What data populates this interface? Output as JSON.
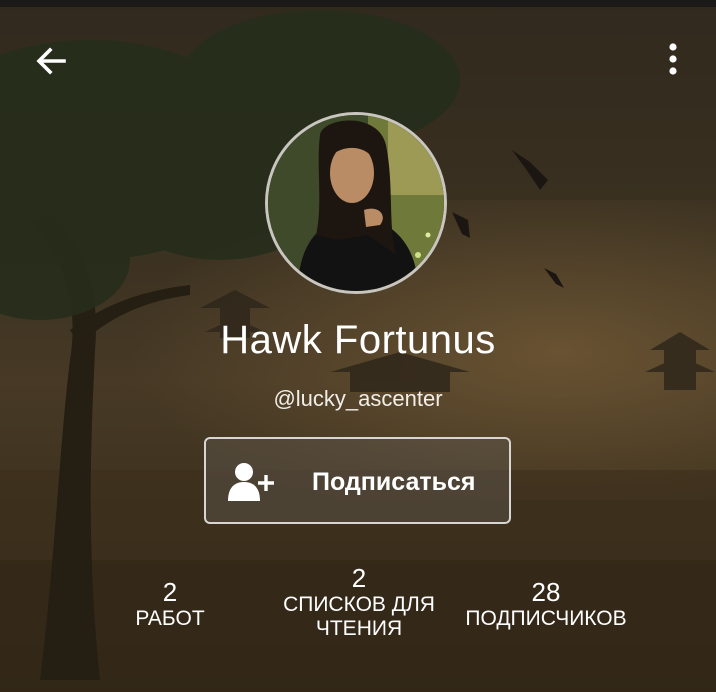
{
  "toolbar": {
    "back_icon": "arrow-left-icon",
    "menu_icon": "more-vertical-icon"
  },
  "profile": {
    "name": "Hawk Fortunus",
    "username": "@lucky_ascenter",
    "follow_label": "Подписаться",
    "follow_icon": "add-user-icon"
  },
  "stats": [
    {
      "value": "2",
      "label_lines": [
        "РАБОТ"
      ]
    },
    {
      "value": "2",
      "label_lines": [
        "СПИСКОВ ДЛЯ",
        "ЧТЕНИЯ"
      ]
    },
    {
      "value": "28",
      "label_lines": [
        "ПОДПИСЧИКОВ"
      ]
    }
  ]
}
